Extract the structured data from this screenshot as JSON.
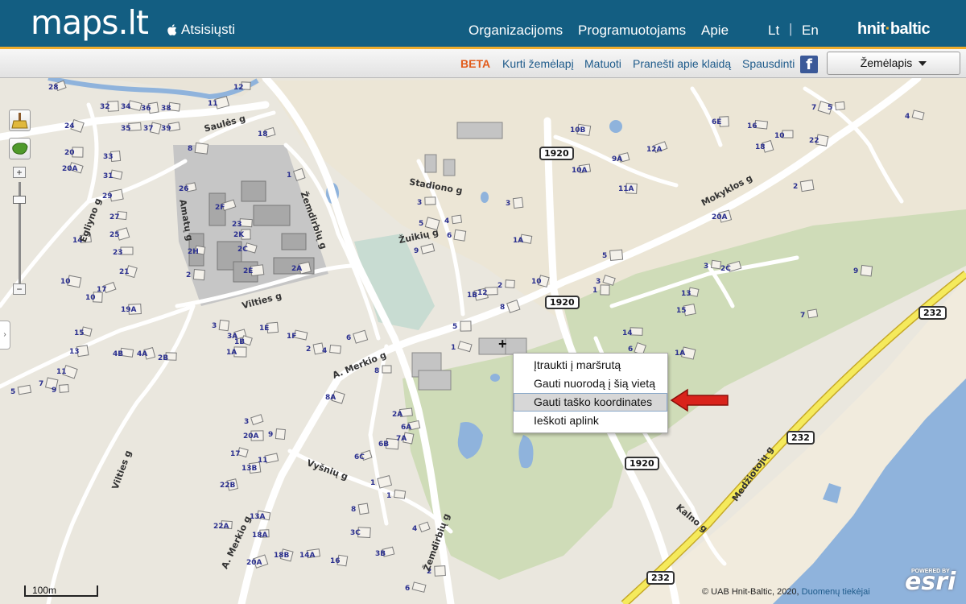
{
  "header": {
    "logo": "maps.lt",
    "download": "Atsisiųsti",
    "nav": [
      "Organizacijoms",
      "Programuotojams",
      "Apie"
    ],
    "lang_lt": "Lt",
    "lang_sep": "|",
    "lang_en": "En",
    "brand_a": "hnit",
    "brand_dot": "·",
    "brand_b": "baltic"
  },
  "toolbar": {
    "beta": "BETA",
    "create_map": "Kurti žemėlapį",
    "measure": "Matuoti",
    "report_error": "Pranešti apie klaidą",
    "print": "Spausdinti",
    "facebook": "f",
    "layer": "Žemėlapis"
  },
  "map": {
    "zoom_plus": "+",
    "zoom_minus": "−",
    "zoom_level": 0.15,
    "side_tab": "›",
    "streets": [
      "Saulės g",
      "Egliyno g",
      "Amatų g",
      "Žemdirbių g",
      "Vilties g",
      "Stadiono g",
      "Žuikių g",
      "Mokyklos g",
      "A. Merkio g",
      "Vyšnių g",
      "Medžiotojų g",
      "Kalno g",
      "Žemdirbių g",
      "A. Merkio g",
      "Vilties g"
    ],
    "shields": [
      "1920",
      "1920",
      "1920",
      "232",
      "232",
      "232"
    ],
    "house_numbers": [
      "28",
      "32",
      "34",
      "36",
      "38",
      "11",
      "12",
      "24",
      "35",
      "37",
      "39",
      "8",
      "18",
      "20",
      "20A",
      "33",
      "31",
      "29",
      "27",
      "25",
      "23",
      "21",
      "14",
      "10",
      "26",
      "2",
      "2F",
      "2K",
      "2C",
      "2E",
      "2H",
      "2A",
      "23",
      "1",
      "3",
      "5",
      "4",
      "6",
      "9",
      "10",
      "17",
      "19A",
      "15",
      "13",
      "4B",
      "4A",
      "2B",
      "11",
      "9",
      "7",
      "5",
      "3",
      "3A",
      "1A",
      "1B",
      "1E",
      "1F",
      "2",
      "4",
      "6",
      "8",
      "8A",
      "2A",
      "7A",
      "6A",
      "6B",
      "6C",
      "5",
      "1",
      "3",
      "1A",
      "1B",
      "2",
      "8",
      "12",
      "10",
      "10A",
      "10B",
      "9A",
      "11A",
      "12A",
      "6E",
      "4",
      "2",
      "3",
      "20A",
      "14",
      "6",
      "1",
      "1A",
      "7",
      "9",
      "2C",
      "1",
      "3",
      "5",
      "13",
      "15",
      "16",
      "18",
      "10",
      "7",
      "5",
      "22",
      "11",
      "9",
      "3",
      "20A",
      "17",
      "13B",
      "13A",
      "22B",
      "22A",
      "20A",
      "18A",
      "18B",
      "14A",
      "16",
      "3B",
      "3C",
      "4",
      "2",
      "6",
      "8",
      "1",
      "1"
    ],
    "context_menu": [
      "Įtraukti į maršrutą",
      "Gauti nuorodą į šią vietą",
      "Gauti taško koordinates",
      "Ieškoti aplink"
    ],
    "context_selected_index": 2,
    "attribution": "© UAB Hnit-Baltic, 2020,",
    "attribution_link": "Duomenų tiekėjai",
    "esri_powered": "POWERED BY",
    "esri": "esri",
    "scale": "100m"
  },
  "colors": {
    "header_bg": "#135e82",
    "accent": "#f0ad2d",
    "water": "#8fb3dc",
    "park": "#cfdcb8",
    "road_major": "#f5ea5c",
    "arrow": "#d9231b"
  }
}
